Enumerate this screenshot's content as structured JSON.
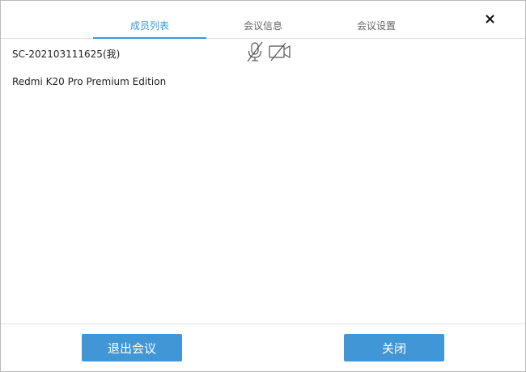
{
  "tabs": [
    {
      "label": "成员列表",
      "active": true
    },
    {
      "label": "会议信息",
      "active": false
    },
    {
      "label": "会议设置",
      "active": false
    }
  ],
  "close_icon": "close-icon",
  "members": [
    {
      "name": "SC-202103111625(我)",
      "mic_icon": "mic-muted-icon",
      "camera_icon": "camera-off-icon"
    },
    {
      "name": "Redmi K20 Pro Premium Edition"
    }
  ],
  "footer": {
    "leave_label": "退出会议",
    "close_label": "关闭"
  },
  "colors": {
    "accent": "#3b9ad9",
    "button": "#4196d6"
  }
}
